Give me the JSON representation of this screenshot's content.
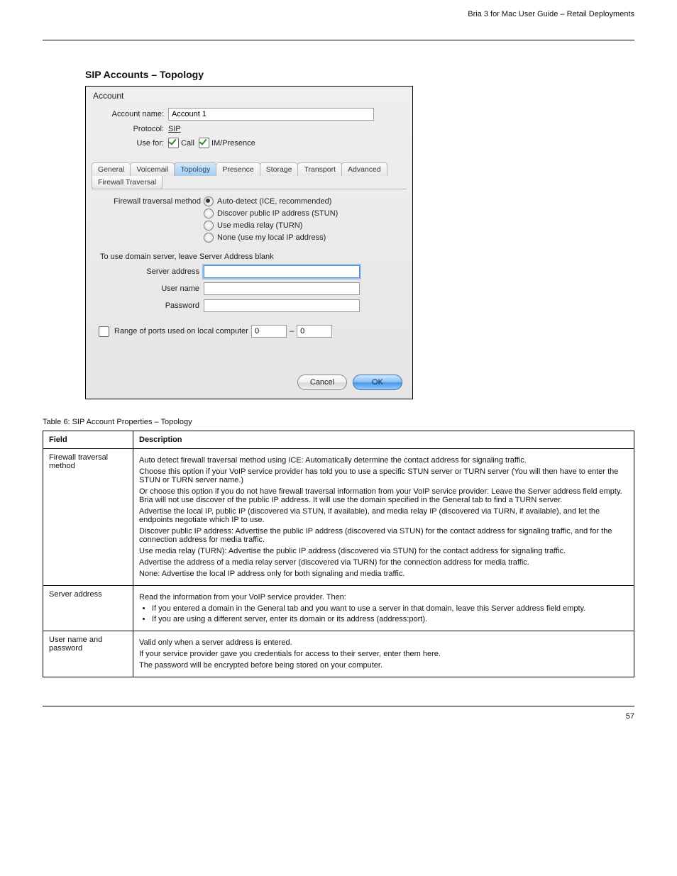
{
  "page_header_right": "Bria 3 for Mac User Guide – Retail Deployments",
  "section_title": "SIP Accounts – Topology",
  "dialog": {
    "title": "Account",
    "account_name_label": "Account name:",
    "account_name_value": "Account 1",
    "protocol_label": "Protocol:",
    "protocol_value": "SIP",
    "use_for_label": "Use for:",
    "use_for_call": "Call",
    "use_for_im": "IM/Presence",
    "tabs": [
      "General",
      "Voicemail",
      "Topology",
      "Presence",
      "Storage",
      "Transport",
      "Advanced"
    ],
    "selected_tab": "Topology",
    "subtab": "Firewall Traversal",
    "ft_method_label": "Firewall traversal method",
    "radio_options": [
      "Auto-detect (ICE, recommended)",
      "Discover public IP address (STUN)",
      "Use media relay (TURN)",
      "None (use my local IP address)"
    ],
    "hint": "To use domain server, leave Server Address blank",
    "server_address_label": "Server address",
    "user_name_label": "User name",
    "password_label": "Password",
    "ports_label": "Range of ports used on local computer",
    "port_from": "0",
    "port_to": "0",
    "cancel": "Cancel",
    "ok": "OK"
  },
  "table_caption": "Table 6: SIP Account Properties – Topology",
  "table": {
    "headers": [
      "Field",
      "Description"
    ],
    "rows": [
      {
        "field": "Firewall traversal method",
        "desc_paragraphs": [
          "Auto detect firewall traversal method using ICE: Automatically determine the contact address for signaling traffic.",
          "Choose this option if your VoIP service provider has told you to use a specific STUN server or TURN server (You will then have to enter the STUN or TURN server name.)",
          "Or choose this option if you do not have firewall traversal information from your VoIP service provider: Leave the Server address field empty. Bria will not use discover of the public IP address. It will use the domain specified in the General tab to find a TURN server.",
          "Advertise the local IP, public IP (discovered via STUN, if available), and media relay IP (discovered via TURN, if available), and let the endpoints negotiate which IP to use.",
          "Discover public IP address: Advertise the public IP address (discovered via STUN) for the contact address for signaling traffic, and for the connection address for media traffic.",
          "Use media relay (TURN): Advertise the public IP address (discovered via STUN) for the contact address for signaling traffic.",
          "Advertise the address of a media relay server (discovered via TURN) for the connection address for media traffic.",
          "None: Advertise the local IP address only for both signaling and media traffic."
        ]
      },
      {
        "field": "Server address",
        "desc_paragraphs": [
          "Read the information from your VoIP service provider. Then:"
        ],
        "desc_bullets": [
          "If you entered a domain in the General tab and you want to use a server in that domain, leave this Server address field empty.",
          "If you are using a different server, enter its domain or its address (address:port)."
        ]
      },
      {
        "field": "User name and password",
        "desc_paragraphs": [
          "Valid only when a server address is entered.",
          "If your service provider gave you credentials for access to their server, enter them here.",
          "The password will be encrypted before being stored on your computer."
        ]
      }
    ]
  },
  "footer_page": "57"
}
